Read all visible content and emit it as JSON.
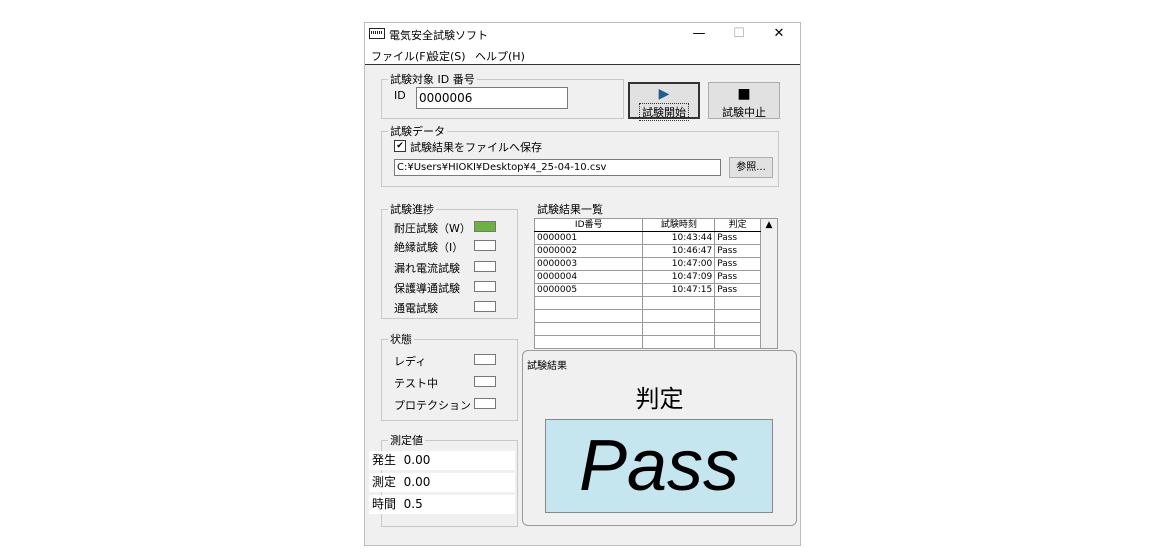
{
  "window": {
    "title": "電気安全試験ソフト",
    "controls": {
      "minimize": "—",
      "maximize": "☐",
      "close": "✕"
    }
  },
  "menu": [
    "ファイル(F)",
    "設定(S)",
    "ヘルプ(H)"
  ],
  "target": {
    "legend": "試験対象 ID 番号",
    "id_label": "ID",
    "id_value": "0000006"
  },
  "buttons": {
    "start_icon": "▶",
    "start_label": "試験開始",
    "stop_icon": "■",
    "stop_label": "試験中止",
    "browse_label": "参照..."
  },
  "test_data": {
    "legend": "試験データ",
    "save_checked": true,
    "save_label": "試験結果をファイルへ保存",
    "path": "C:¥Users¥HIOKI¥Desktop¥4_25-04-10.csv"
  },
  "progress": {
    "legend": "試験進捗",
    "items": [
      {
        "label": "耐圧試験（W）",
        "color": "#6ab33e"
      },
      {
        "label": "絶縁試験（I）",
        "color": "#ffffff"
      },
      {
        "label": "漏れ電流試験",
        "color": "#ffffff"
      },
      {
        "label": "保護導通試験",
        "color": "#ffffff"
      },
      {
        "label": "通電試験",
        "color": "#ffffff"
      }
    ]
  },
  "status": {
    "legend": "状態",
    "items": [
      "レディ",
      "テスト中",
      "プロテクション"
    ]
  },
  "measure": {
    "legend": "測定値",
    "rows": [
      {
        "label": "発生",
        "value": "0.00"
      },
      {
        "label": "測定",
        "value": "0.00"
      },
      {
        "label": "時間",
        "value": "0.5"
      }
    ]
  },
  "results": {
    "title": "試験結果一覧",
    "headers": [
      "ID番号",
      "試験時刻",
      "判定"
    ],
    "rows": [
      [
        "0000001",
        "10:43:44",
        "Pass"
      ],
      [
        "0000002",
        "10:46:47",
        "Pass"
      ],
      [
        "0000003",
        "10:47:00",
        "Pass"
      ],
      [
        "0000004",
        "10:47:09",
        "Pass"
      ],
      [
        "0000005",
        "10:47:15",
        "Pass"
      ]
    ],
    "scroll_up": "▲"
  },
  "popup": {
    "title": "試験結果",
    "heading": "判定",
    "verdict": "Pass"
  }
}
